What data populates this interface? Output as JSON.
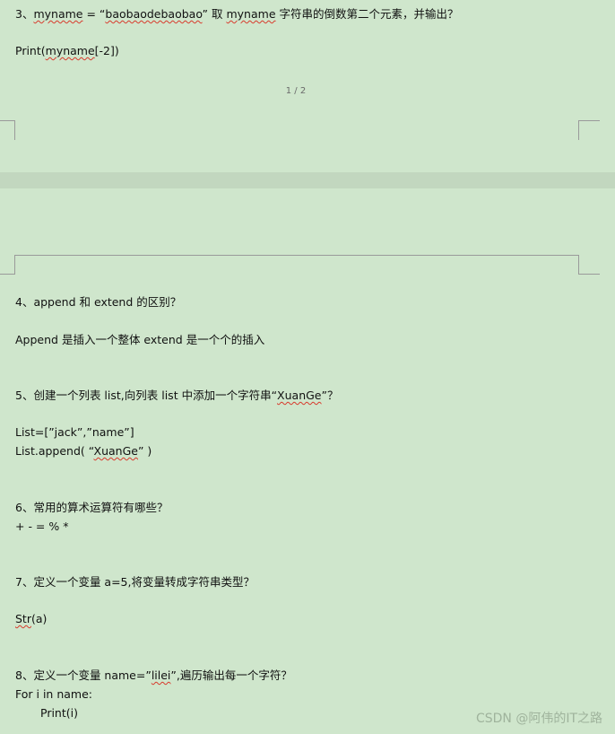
{
  "page1": {
    "q3": {
      "prefix": "3、",
      "var1": "myname",
      "eq": " = ",
      "qopen": "“",
      "str": "baobaodebaobao",
      "qclose": "”",
      "mid": " 取 ",
      "var2": "myname",
      "rest": " 字符串的倒数第二个元素，并输出？"
    },
    "a3": {
      "prefix": "Print(",
      "var": "myname",
      "suffix": "[-2])"
    },
    "page_number": "1 / 2"
  },
  "page2": {
    "q4": "4、append 和 extend 的区别？",
    "a4": "Append 是插入一个整体  extend 是一个个的插入",
    "q5": {
      "text": "5、创建一个列表 list,向列表 list 中添加一个字符串“",
      "word": "XuanGe",
      "end": "”？"
    },
    "a5_line1": "List=[”jack”,”name”]",
    "a5_line2": {
      "prefix": "List.append( “",
      "word": "XuanGe",
      "end": "” )"
    },
    "q6": "6、常用的算术运算符有哪些？",
    "a6": "+ - = % *",
    "q7": "7、定义一个变量 a=5,将变量转成字符串类型？",
    "a7": {
      "word": "Str",
      "rest": "(a)"
    },
    "q8": {
      "text": "8、定义一个变量 name=”",
      "word": "lilei",
      "end": "”,遍历输出每一个字符？"
    },
    "a8_line1": "For i in name:",
    "a8_line2": "Print(i)"
  },
  "watermark": "CSDN @阿伟的IT之路"
}
